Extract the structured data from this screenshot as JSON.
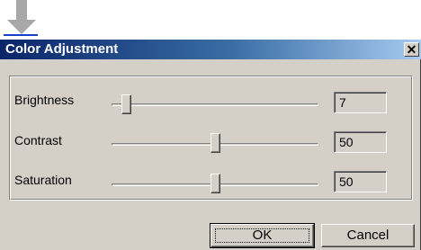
{
  "dialog": {
    "title": "Color Adjustment",
    "close_symbol": "✕"
  },
  "decor": {
    "arrow_icon": "down-arrow-icon",
    "arrow_color": "#a0a0a0",
    "link_color": "#1a3fd0"
  },
  "sliders": [
    {
      "label": "Brightness",
      "value": "7",
      "position_fraction": 0.07
    },
    {
      "label": "Contrast",
      "value": "50",
      "position_fraction": 0.5
    },
    {
      "label": "Saturation",
      "value": "50",
      "position_fraction": 0.5
    }
  ],
  "buttons": {
    "ok_label": "OK",
    "cancel_label": "Cancel"
  },
  "colors": {
    "dialog_face": "#d4d0c8",
    "titlebar_start": "#0a246a",
    "titlebar_end": "#a6caf0"
  }
}
